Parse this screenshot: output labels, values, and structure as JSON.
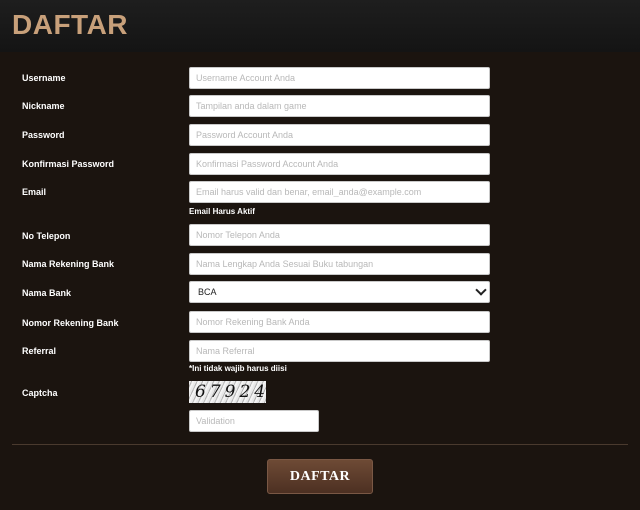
{
  "header": {
    "title": "DAFTAR"
  },
  "form": {
    "fields": [
      {
        "label": "Username",
        "placeholder": "Username Account Anda",
        "value": ""
      },
      {
        "label": "Nickname",
        "placeholder": "Tampilan anda dalam game",
        "value": ""
      },
      {
        "label": "Password",
        "placeholder": "Password Account Anda",
        "value": ""
      },
      {
        "label": "Konfirmasi Password",
        "placeholder": "Konfirmasi Password Account Anda",
        "value": ""
      },
      {
        "label": "Email",
        "placeholder": "Email harus valid dan benar, email_anda@example.com",
        "value": ""
      },
      {
        "label": "No Telepon",
        "placeholder": "Nomor Telepon Anda",
        "value": ""
      },
      {
        "label": "Nama Rekening Bank",
        "placeholder": "Nama Lengkap Anda Sesuai Buku tabungan",
        "value": ""
      },
      {
        "label": "Nama Bank",
        "selected": "BCA"
      },
      {
        "label": "Nomor Rekening Bank",
        "placeholder": "Nomor Rekening Bank Anda",
        "value": ""
      },
      {
        "label": "Referral",
        "placeholder": "Nama Referral",
        "value": ""
      }
    ],
    "email_hint": "Email Harus Aktif",
    "referral_hint": "*Ini tidak wajib harus diisi",
    "captcha": {
      "label": "Captcha",
      "image_text": "67924",
      "validation_placeholder": "Validation"
    },
    "submit_label": "DAFTAR"
  }
}
